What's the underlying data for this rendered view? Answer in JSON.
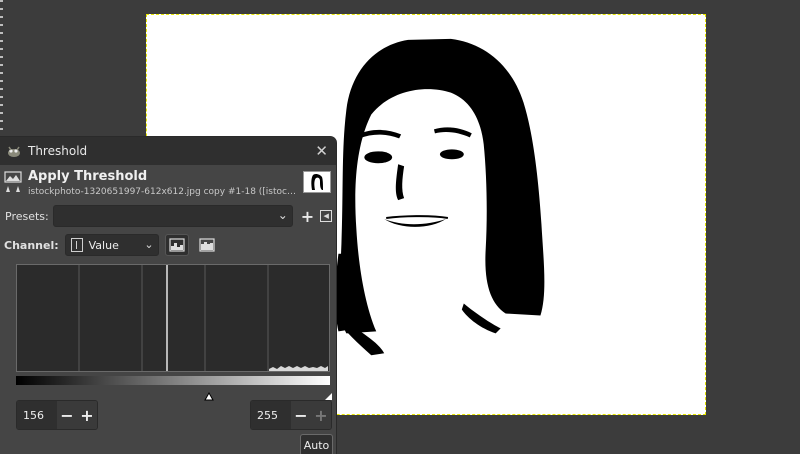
{
  "dialog": {
    "window_title": "Threshold",
    "op_title": "Apply Threshold",
    "op_subtitle": "istockphoto-1320651997-612x612.jpg copy #1-18 ([istockphoto-1...",
    "presets_label": "Presets:",
    "presets_value": "",
    "channel_label": "Channel:",
    "channel_value": "Value",
    "low_value": "156",
    "high_value": "255",
    "auto_label": "Auto"
  },
  "icons": {
    "window": "gimp-wilber-icon",
    "operation": "threshold-icon",
    "close": "close-icon",
    "add_preset": "plus-icon",
    "preset_menu": "menu-icon",
    "linear_scale": "linear-histogram-icon",
    "log_scale": "log-histogram-icon"
  },
  "colors": {
    "canvas_bg": "#ffffff",
    "canvas_border": "#e6e600",
    "dialog_bg": "#454545",
    "workspace_bg": "#3c3c3c"
  }
}
